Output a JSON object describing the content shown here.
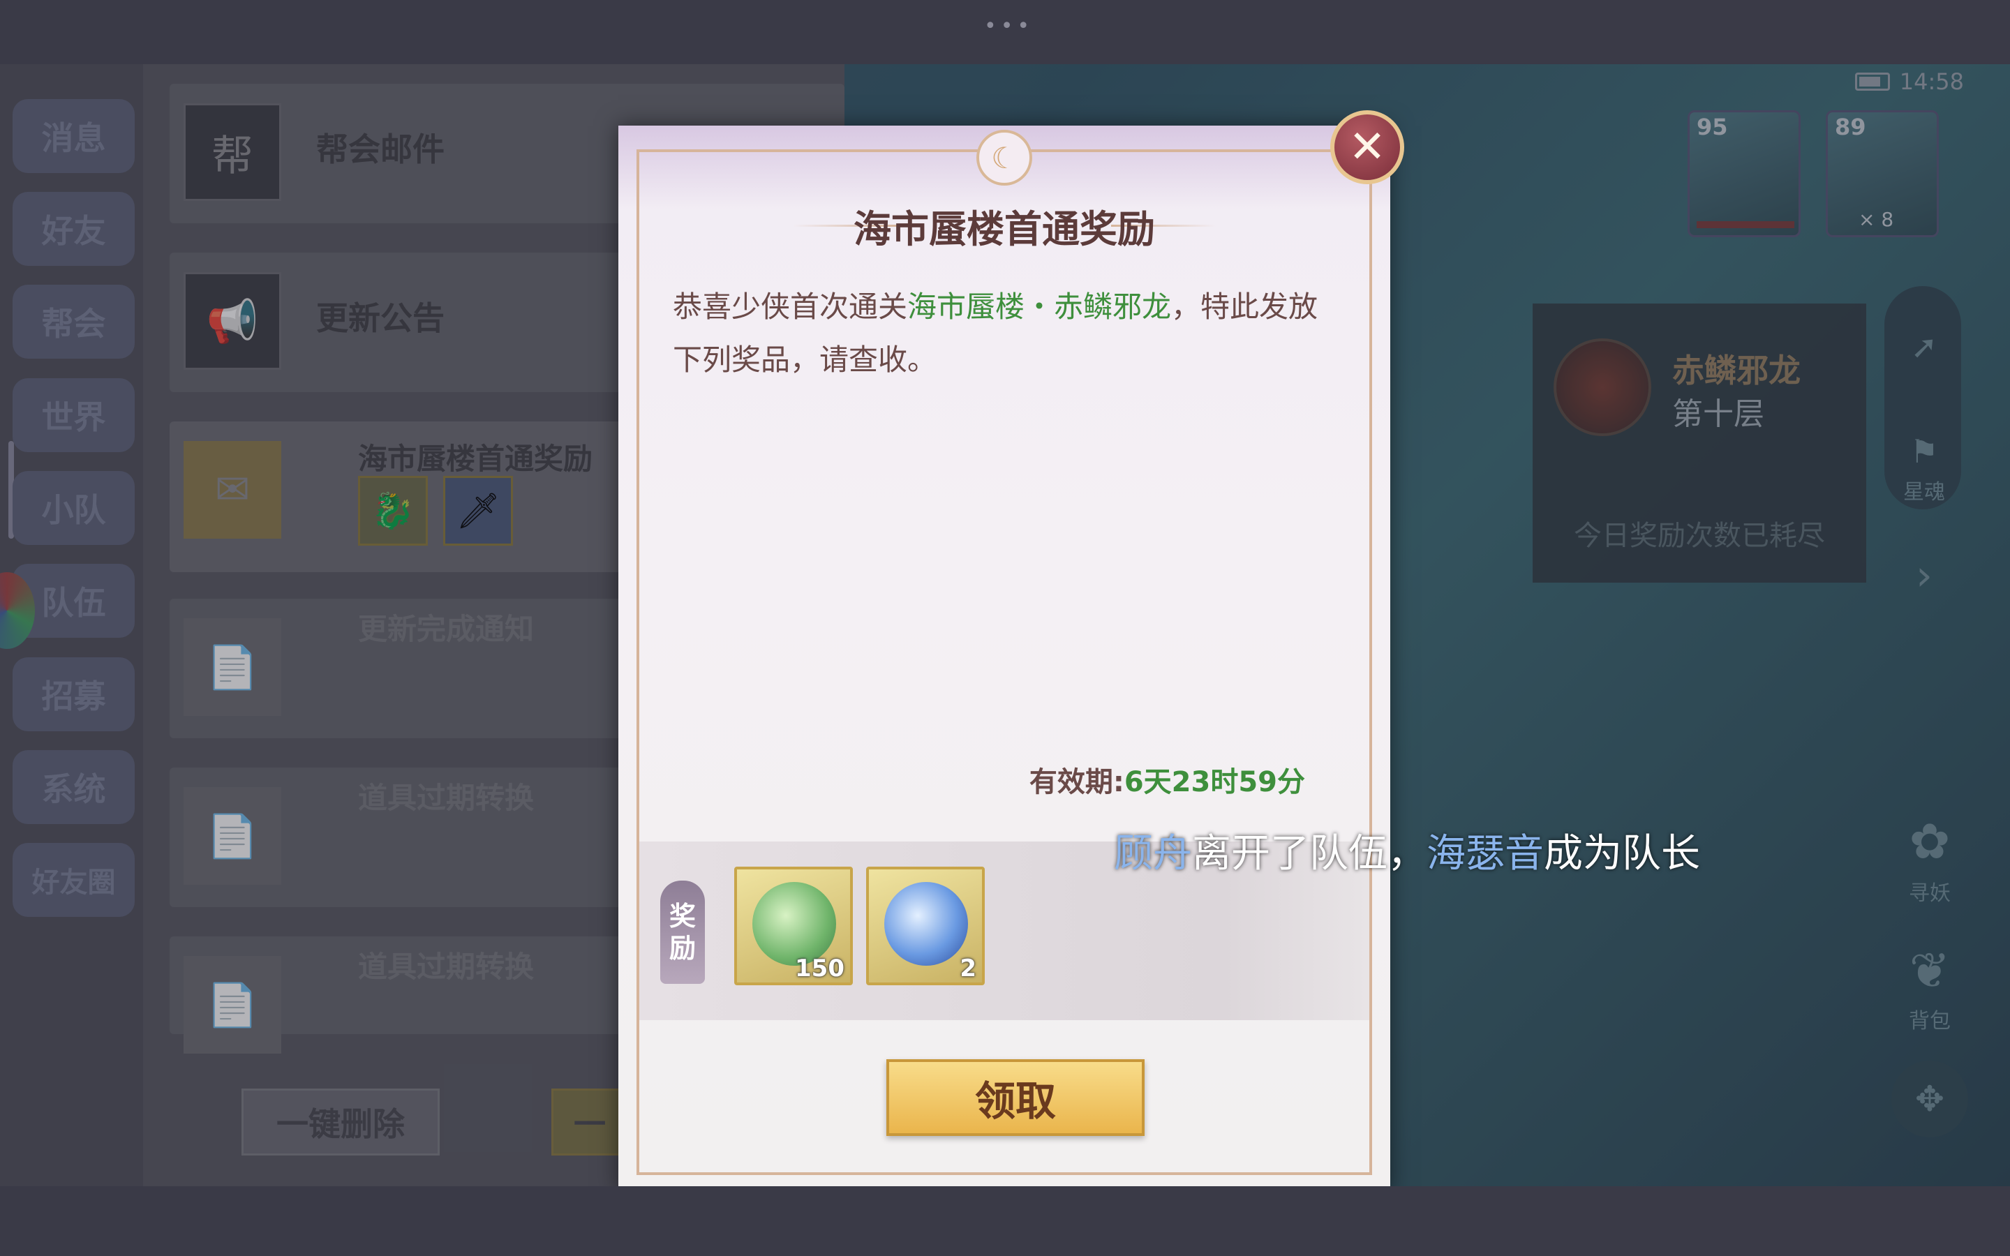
{
  "system": {
    "time": "14:58"
  },
  "mail_tabs": [
    "消息",
    "好友",
    "帮会",
    "世界",
    "小队",
    "队伍",
    "招募",
    "系统",
    "好友圈"
  ],
  "mail_list": [
    {
      "title": "帮会邮件",
      "icon": "帮"
    },
    {
      "title": "更新公告",
      "icon": "megaphone"
    },
    {
      "title": "海市蜃楼首通奖励",
      "icon": "envelope"
    },
    {
      "title": "更新完成通知",
      "icon": "letter"
    },
    {
      "title": "道具过期转换",
      "icon": "letter"
    },
    {
      "title": "道具过期转换",
      "icon": "letter"
    }
  ],
  "mail_buttons": {
    "delete_all": "一键删除",
    "claim_all": "一"
  },
  "party": [
    {
      "level": "95"
    },
    {
      "level": "89",
      "badge": "× 8"
    }
  ],
  "boss": {
    "name": "赤鳞邪龙",
    "floor": "第十层",
    "note": "今日奖励次数已耗尽"
  },
  "right_menu": {
    "star_soul": "星魂",
    "seek": "寻妖",
    "bag": "背包"
  },
  "dialog": {
    "title": "海市蜃楼首通奖励",
    "body_prefix": "恭喜少侠首次通关",
    "body_highlight": "海市蜃楼・赤鳞邪龙",
    "body_suffix": "，特此发放下列奖品，请查收。",
    "validity_label": "有效期:",
    "validity_value": "6天23时59分",
    "reward_tag": [
      "奖",
      "励"
    ],
    "rewards": [
      {
        "icon": "green-dragon-token-icon",
        "count": "150"
      },
      {
        "icon": "blue-sword-orb-icon",
        "count": "2"
      }
    ],
    "claim_label": "领取",
    "close_icon": "close-icon"
  },
  "toast": {
    "name1": "顾舟",
    "text1": "离开了队伍，",
    "name2": "海瑟音",
    "text2": "成为队长"
  },
  "colors": {
    "highlight": "#3e8f3c",
    "title": "#5c3b3a",
    "claim_button": "#eab54c",
    "close_button": "#7a2e3a"
  }
}
